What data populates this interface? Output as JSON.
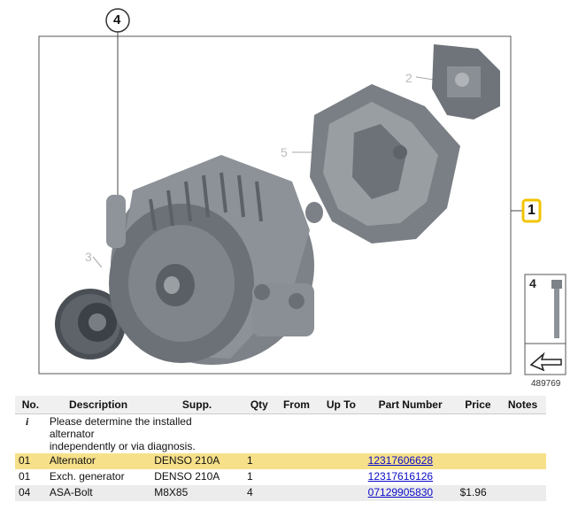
{
  "diagram": {
    "callouts": [
      {
        "id": "1",
        "text": "1"
      },
      {
        "id": "2",
        "text": "2"
      },
      {
        "id": "3",
        "text": "3"
      },
      {
        "id": "4",
        "text": "4"
      },
      {
        "id": "5",
        "text": "5"
      }
    ],
    "inset_label": "4",
    "image_id": "489769",
    "highlight_color": "#f2c400"
  },
  "table": {
    "headers": [
      "No.",
      "Description",
      "Supp.",
      "Qty",
      "From",
      "Up To",
      "Part Number",
      "Price",
      "Notes"
    ],
    "info_row": {
      "icon": "i",
      "lines": [
        "Please determine the installed",
        "alternator",
        "independently or via diagnosis."
      ]
    },
    "rows": [
      {
        "no": "01",
        "description": "Alternator",
        "supp": "DENSO 210A",
        "qty": "1",
        "from": "",
        "upto": "",
        "part_number": "12317606628",
        "price": "",
        "notes": ""
      },
      {
        "no": "01",
        "description": "Exch. generator",
        "supp": "DENSO 210A",
        "qty": "1",
        "from": "",
        "upto": "",
        "part_number": "12317616126",
        "price": "",
        "notes": ""
      },
      {
        "no": "04",
        "description": "ASA-Bolt",
        "supp": "M8X85",
        "qty": "4",
        "from": "",
        "upto": "",
        "part_number": "07129905830",
        "price": "$1.96",
        "notes": ""
      }
    ]
  }
}
